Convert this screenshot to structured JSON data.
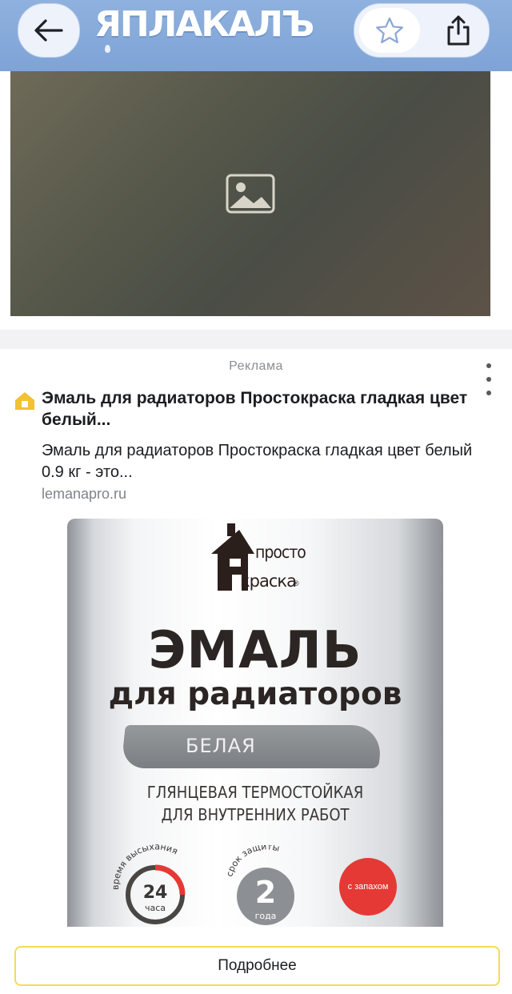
{
  "header": {
    "back_icon": "arrow-left-icon",
    "logo_text": "ЯПЛАКАЛЪ",
    "favorite_icon": "star-outline-icon",
    "share_icon": "share-icon",
    "bar_color": "#7ea3d6"
  },
  "post": {
    "photo_icon": "image-icon"
  },
  "ad": {
    "label": "Реклама",
    "menu_icon": "more-vertical-icon",
    "site_icon": "house-icon",
    "title": "Эмаль для радиаторов Простокраска гладкая цвет белый...",
    "description": "Эмаль для радиаторов Простокраска гладкая цвет белый 0.9 кг - это...",
    "domain": "lemanapro.ru",
    "image": {
      "brand_line1": "просто",
      "brand_line2": "краска",
      "reg_mark": "®",
      "heading": "ЭМАЛЬ",
      "subheading": "для радиаторов",
      "color_label": "БЕЛАЯ",
      "spec_line1": "ГЛЯНЦЕВАЯ ТЕРМОСТОЙКАЯ",
      "spec_line2": "ДЛЯ ВНУТРЕННИХ РАБОТ",
      "dry_label": "время высыхания",
      "dry_value": "24",
      "dry_unit": "часа",
      "protection_label": "срок защиты",
      "protection_value": "2",
      "protection_unit": "года",
      "smell_label": "с запахом"
    },
    "button_label": "Подробнее",
    "button_border_color": "#f3dc55"
  }
}
